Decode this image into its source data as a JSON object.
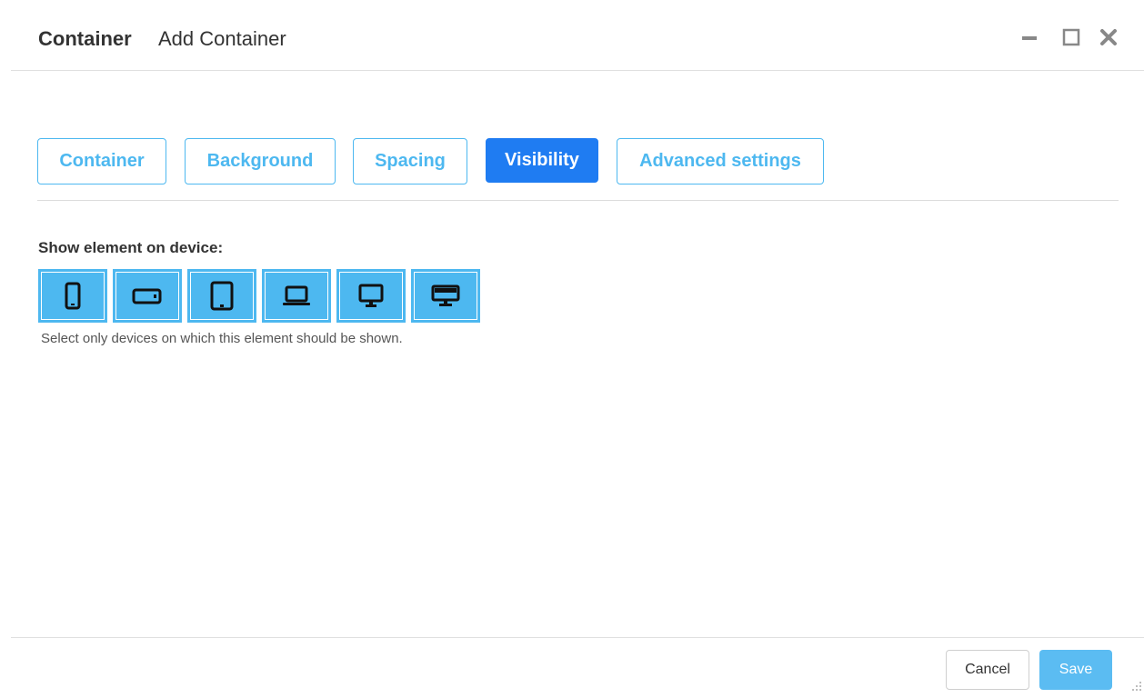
{
  "header": {
    "title": "Container",
    "subtitle": "Add Container"
  },
  "tabs": [
    {
      "label": "Container",
      "active": false
    },
    {
      "label": "Background",
      "active": false
    },
    {
      "label": "Spacing",
      "active": false
    },
    {
      "label": "Visibility",
      "active": true
    },
    {
      "label": "Advanced settings",
      "active": false
    }
  ],
  "visibility": {
    "label": "Show element on device:",
    "devices": [
      {
        "icon": "phone-portrait-icon",
        "selected": true
      },
      {
        "icon": "phone-landscape-icon",
        "selected": true
      },
      {
        "icon": "tablet-portrait-icon",
        "selected": true
      },
      {
        "icon": "laptop-icon",
        "selected": true
      },
      {
        "icon": "desktop-icon",
        "selected": true
      },
      {
        "icon": "large-desktop-icon",
        "selected": true
      }
    ],
    "help": "Select only devices on which this element should be shown."
  },
  "footer": {
    "cancel_label": "Cancel",
    "save_label": "Save"
  },
  "colors": {
    "accent": "#4db8f0",
    "active_tab": "#1f7cf2",
    "save_button": "#5bbcf2"
  }
}
